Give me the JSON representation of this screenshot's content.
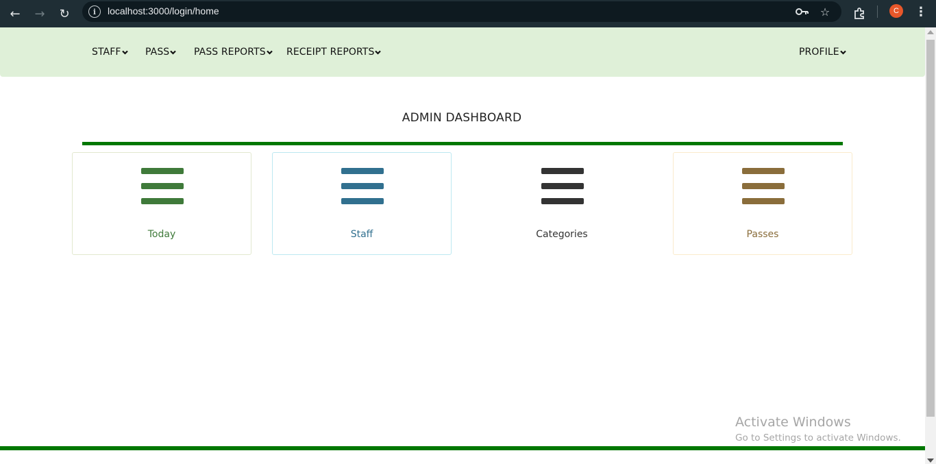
{
  "browser": {
    "url": "localhost:3000/login/home",
    "profile_initial": "C"
  },
  "navbar": {
    "items": [
      {
        "label": "STAFF"
      },
      {
        "label": "PASS"
      },
      {
        "label": "PASS REPORTS"
      },
      {
        "label": "RECEIPT REPORTS"
      }
    ],
    "profile_label": "PROFILE"
  },
  "main": {
    "title": "ADMIN DASHBOARD",
    "rule_color": "#007700",
    "cards": [
      {
        "label": "Today",
        "color": "#3f7a3a",
        "border": "#e2e8cf"
      },
      {
        "label": "Staff",
        "color": "#31708f",
        "border": "#bce8f1"
      },
      {
        "label": "Categories",
        "color": "#333333",
        "border": "none"
      },
      {
        "label": "Passes",
        "color": "#8a6d3b",
        "border": "#faebcc"
      }
    ]
  },
  "watermark": {
    "line1": "Activate Windows",
    "line2": "Go to Settings to activate Windows."
  }
}
